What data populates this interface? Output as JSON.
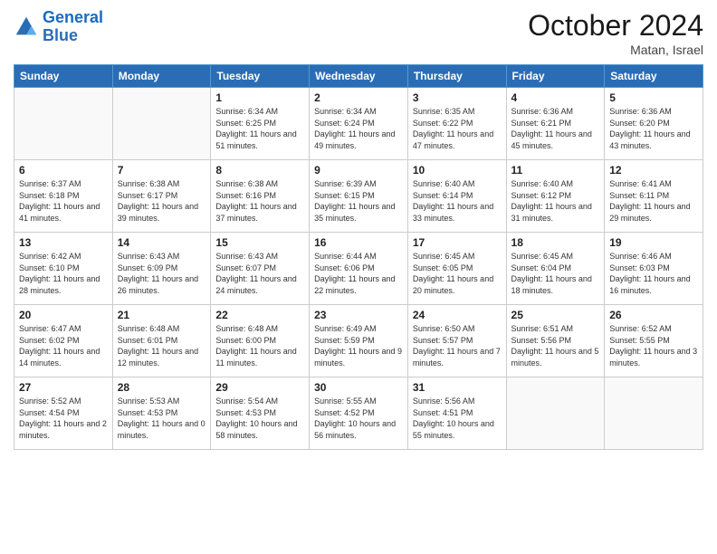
{
  "header": {
    "logo_line1": "General",
    "logo_line2": "Blue",
    "month": "October 2024",
    "location": "Matan, Israel"
  },
  "weekdays": [
    "Sunday",
    "Monday",
    "Tuesday",
    "Wednesday",
    "Thursday",
    "Friday",
    "Saturday"
  ],
  "weeks": [
    [
      {
        "day": "",
        "info": ""
      },
      {
        "day": "",
        "info": ""
      },
      {
        "day": "1",
        "info": "Sunrise: 6:34 AM\nSunset: 6:25 PM\nDaylight: 11 hours and 51 minutes."
      },
      {
        "day": "2",
        "info": "Sunrise: 6:34 AM\nSunset: 6:24 PM\nDaylight: 11 hours and 49 minutes."
      },
      {
        "day": "3",
        "info": "Sunrise: 6:35 AM\nSunset: 6:22 PM\nDaylight: 11 hours and 47 minutes."
      },
      {
        "day": "4",
        "info": "Sunrise: 6:36 AM\nSunset: 6:21 PM\nDaylight: 11 hours and 45 minutes."
      },
      {
        "day": "5",
        "info": "Sunrise: 6:36 AM\nSunset: 6:20 PM\nDaylight: 11 hours and 43 minutes."
      }
    ],
    [
      {
        "day": "6",
        "info": "Sunrise: 6:37 AM\nSunset: 6:18 PM\nDaylight: 11 hours and 41 minutes."
      },
      {
        "day": "7",
        "info": "Sunrise: 6:38 AM\nSunset: 6:17 PM\nDaylight: 11 hours and 39 minutes."
      },
      {
        "day": "8",
        "info": "Sunrise: 6:38 AM\nSunset: 6:16 PM\nDaylight: 11 hours and 37 minutes."
      },
      {
        "day": "9",
        "info": "Sunrise: 6:39 AM\nSunset: 6:15 PM\nDaylight: 11 hours and 35 minutes."
      },
      {
        "day": "10",
        "info": "Sunrise: 6:40 AM\nSunset: 6:14 PM\nDaylight: 11 hours and 33 minutes."
      },
      {
        "day": "11",
        "info": "Sunrise: 6:40 AM\nSunset: 6:12 PM\nDaylight: 11 hours and 31 minutes."
      },
      {
        "day": "12",
        "info": "Sunrise: 6:41 AM\nSunset: 6:11 PM\nDaylight: 11 hours and 29 minutes."
      }
    ],
    [
      {
        "day": "13",
        "info": "Sunrise: 6:42 AM\nSunset: 6:10 PM\nDaylight: 11 hours and 28 minutes."
      },
      {
        "day": "14",
        "info": "Sunrise: 6:43 AM\nSunset: 6:09 PM\nDaylight: 11 hours and 26 minutes."
      },
      {
        "day": "15",
        "info": "Sunrise: 6:43 AM\nSunset: 6:07 PM\nDaylight: 11 hours and 24 minutes."
      },
      {
        "day": "16",
        "info": "Sunrise: 6:44 AM\nSunset: 6:06 PM\nDaylight: 11 hours and 22 minutes."
      },
      {
        "day": "17",
        "info": "Sunrise: 6:45 AM\nSunset: 6:05 PM\nDaylight: 11 hours and 20 minutes."
      },
      {
        "day": "18",
        "info": "Sunrise: 6:45 AM\nSunset: 6:04 PM\nDaylight: 11 hours and 18 minutes."
      },
      {
        "day": "19",
        "info": "Sunrise: 6:46 AM\nSunset: 6:03 PM\nDaylight: 11 hours and 16 minutes."
      }
    ],
    [
      {
        "day": "20",
        "info": "Sunrise: 6:47 AM\nSunset: 6:02 PM\nDaylight: 11 hours and 14 minutes."
      },
      {
        "day": "21",
        "info": "Sunrise: 6:48 AM\nSunset: 6:01 PM\nDaylight: 11 hours and 12 minutes."
      },
      {
        "day": "22",
        "info": "Sunrise: 6:48 AM\nSunset: 6:00 PM\nDaylight: 11 hours and 11 minutes."
      },
      {
        "day": "23",
        "info": "Sunrise: 6:49 AM\nSunset: 5:59 PM\nDaylight: 11 hours and 9 minutes."
      },
      {
        "day": "24",
        "info": "Sunrise: 6:50 AM\nSunset: 5:57 PM\nDaylight: 11 hours and 7 minutes."
      },
      {
        "day": "25",
        "info": "Sunrise: 6:51 AM\nSunset: 5:56 PM\nDaylight: 11 hours and 5 minutes."
      },
      {
        "day": "26",
        "info": "Sunrise: 6:52 AM\nSunset: 5:55 PM\nDaylight: 11 hours and 3 minutes."
      }
    ],
    [
      {
        "day": "27",
        "info": "Sunrise: 5:52 AM\nSunset: 4:54 PM\nDaylight: 11 hours and 2 minutes."
      },
      {
        "day": "28",
        "info": "Sunrise: 5:53 AM\nSunset: 4:53 PM\nDaylight: 11 hours and 0 minutes."
      },
      {
        "day": "29",
        "info": "Sunrise: 5:54 AM\nSunset: 4:53 PM\nDaylight: 10 hours and 58 minutes."
      },
      {
        "day": "30",
        "info": "Sunrise: 5:55 AM\nSunset: 4:52 PM\nDaylight: 10 hours and 56 minutes."
      },
      {
        "day": "31",
        "info": "Sunrise: 5:56 AM\nSunset: 4:51 PM\nDaylight: 10 hours and 55 minutes."
      },
      {
        "day": "",
        "info": ""
      },
      {
        "day": "",
        "info": ""
      }
    ]
  ]
}
